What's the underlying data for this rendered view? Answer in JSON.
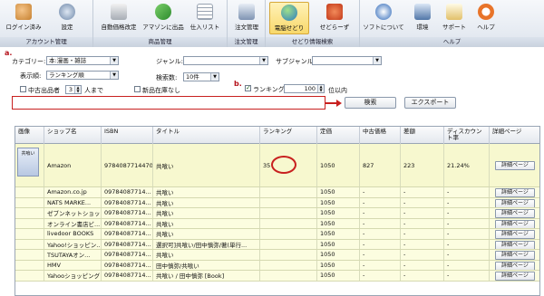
{
  "ribbon": {
    "groups": [
      {
        "label": "アカウント管理",
        "buttons": [
          "ログイン済み",
          "設定"
        ]
      },
      {
        "label": "商品管理",
        "buttons": [
          "自動価格改定",
          "アマゾンに出品",
          "仕入リスト"
        ]
      },
      {
        "label": "注文管理",
        "buttons": [
          "注文管理"
        ]
      },
      {
        "label": "せどり情報検索",
        "buttons": [
          "電脳せどり",
          "せどらーず"
        ]
      },
      {
        "label": "ヘルプ",
        "buttons": [
          "ソフトについて",
          "環境",
          "サポート",
          "ヘルプ"
        ]
      }
    ],
    "active_button": "電脳せどり",
    "accent": "#f8d86a"
  },
  "filters": {
    "annot_a": "a.",
    "annot_b": "b.",
    "category_label": "カテゴリー:",
    "category_value": "本:漫画・雑誌",
    "display_label": "表示順:",
    "display_value": "ランキング順",
    "genre_label": "ジャンル:",
    "genre_value": "",
    "subgenre_label": "サブジャンル:",
    "subgenre_value": "",
    "count_label": "検索数:",
    "count_value": "10件",
    "used_label": "中古出品者",
    "used_value": "3",
    "used_suffix": "人まで",
    "new_label": "新品在庫なし",
    "ranking_label": "ランキング",
    "ranking_value": "100",
    "ranking_suffix": "位以内",
    "keyword_value": "",
    "search_button": "検索",
    "export_button": "エクスポート",
    "highlight_color": "#c8201f"
  },
  "table": {
    "headers": [
      "画像",
      "ショップ名",
      "ISBN",
      "タイトル",
      "ランキング",
      "定価",
      "中古価格",
      "差額",
      "ディスカウント率",
      "詳細ページ"
    ],
    "thumb_caption": "共喰い",
    "detail_label": "詳細ページ",
    "rows": [
      [
        "Amazon",
        "9784087714470",
        "共喰い",
        "35",
        "1050",
        "827",
        "223",
        "21.24%"
      ],
      [
        "Amazon.co.jp",
        "09784087714...",
        "共喰い",
        "",
        "1050",
        "-",
        "-",
        "-"
      ],
      [
        "NATS MARKE...",
        "09784087714...",
        "共喰い",
        "",
        "1050",
        "-",
        "-",
        "-"
      ],
      [
        "ゼブンネットショッ...",
        "09784087714...",
        "共喰い",
        "",
        "1050",
        "-",
        "-",
        "-"
      ],
      [
        "オンライン書店ビ...",
        "09784087714...",
        "共喰い",
        "",
        "1050",
        "-",
        "-",
        "-"
      ],
      [
        "livedoor BOOKS",
        "09784087714...",
        "共喰い",
        "",
        "1050",
        "-",
        "-",
        "-"
      ],
      [
        "Yahoo!ショッピン...",
        "09784087714...",
        "選択可]共喰い/田中慎弥/著(単行...",
        "",
        "1050",
        "-",
        "-",
        "-"
      ],
      [
        "TSUTAYAオン...",
        "09784087714...",
        "共喰い",
        "",
        "1050",
        "-",
        "-",
        "-"
      ],
      [
        "HMV",
        "09784087714...",
        "田中慎弥/共喰い",
        "",
        "1050",
        "-",
        "-",
        "-"
      ],
      [
        "Yahooショッピング",
        "09784087714...",
        "共喰い / 田中慎弥 [Book]",
        "",
        "1050",
        "-",
        "-",
        "-"
      ]
    ]
  }
}
